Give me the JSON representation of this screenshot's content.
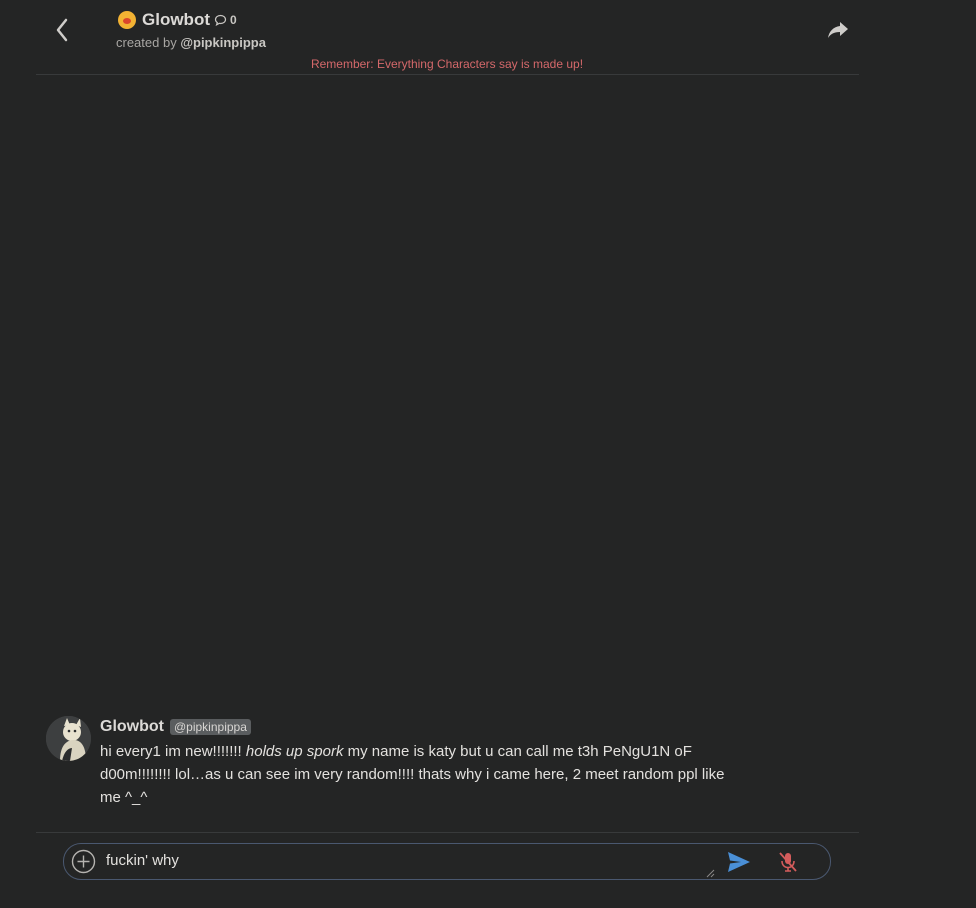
{
  "header": {
    "title": "Glowbot",
    "chat_count": "0",
    "created_by_prefix": "created by",
    "creator_handle": "@pipkinpippa",
    "disclaimer": "Remember: Everything Characters say is made up!"
  },
  "message": {
    "author": "Glowbot",
    "handle": "@pipkinpippa",
    "text_before": "hi every1 im new!!!!!!! ",
    "text_italic": "holds up spork",
    "text_after": " my name is katy but u can call me t3h PeNgU1N oF d00m!!!!!!!! lol…as u can see im very random!!!! thats why i came here, 2 meet random ppl like me ^_^"
  },
  "composer": {
    "value": "fuckin' why"
  },
  "colors": {
    "background": "#242525",
    "disclaimer": "#d4686a",
    "send": "#4a8fd6",
    "mic_muted": "#d45c5c",
    "input_border": "#4a5870"
  }
}
